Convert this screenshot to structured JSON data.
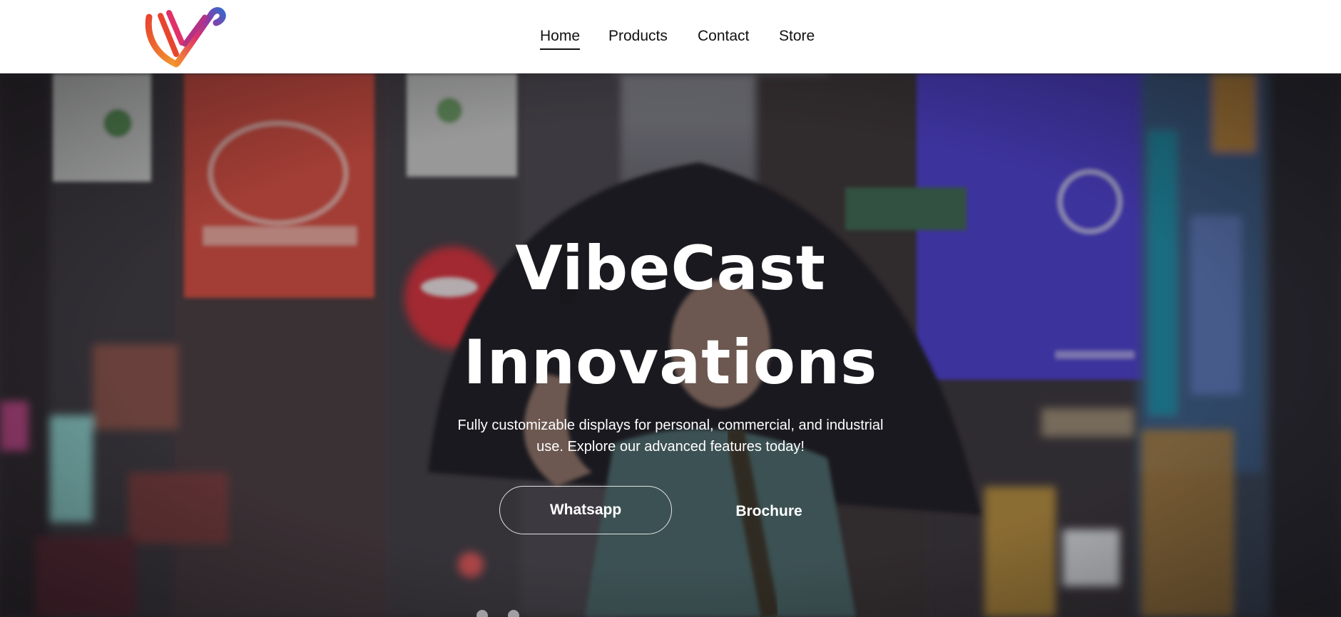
{
  "brand": {
    "logo_icon": "vibecast-v-check-logo",
    "gradient_colors": [
      "#f28a2e",
      "#e0316b",
      "#6a3da8",
      "#3a68c8"
    ]
  },
  "nav": {
    "items": [
      {
        "label": "Home",
        "active": true
      },
      {
        "label": "Products",
        "active": false
      },
      {
        "label": "Contact",
        "active": false
      },
      {
        "label": "Store",
        "active": false
      }
    ]
  },
  "hero": {
    "title_line1": "VibeCast",
    "title_line2": "Innovations",
    "subtitle": "Fully customizable displays for personal, commercial, and industrial use. Explore our advanced features today!",
    "primary_button": "Whatsapp",
    "secondary_button": "Brochure",
    "background": "city-street-with-billboards-person-with-umbrella-photo",
    "slides": 2
  },
  "colors": {
    "text_on_hero": "#ffffff",
    "nav_text": "#111111",
    "header_bg": "#ffffff"
  }
}
